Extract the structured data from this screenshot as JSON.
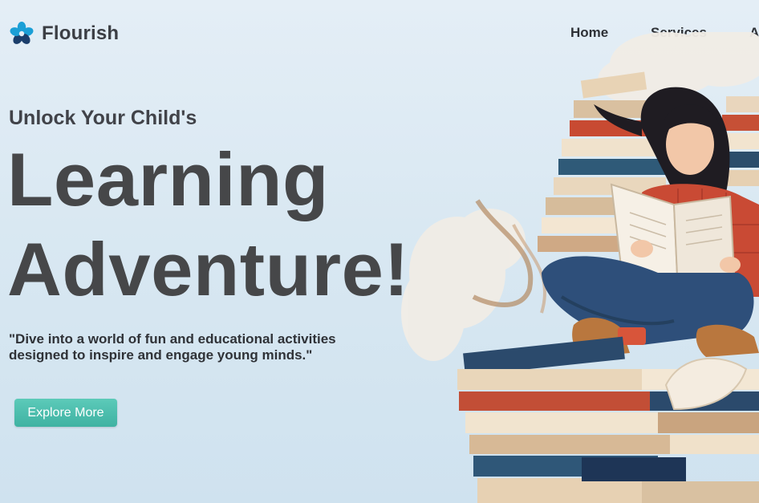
{
  "brand": {
    "name": "Flourish",
    "logo_icon": "flower-icon",
    "logo_colors": [
      "#1b9fd6",
      "#1b3e6b"
    ]
  },
  "nav": {
    "items": [
      "Home",
      "Services",
      "A"
    ]
  },
  "hero": {
    "eyebrow": "Unlock Your Child's",
    "headline_line1": "Learning",
    "headline_line2": "Adventure!",
    "tagline": "\"Dive into a world of fun and educational activities designed to inspire and engage young minds.\"",
    "cta_label": "Explore More",
    "cta_color": "#4dbfae"
  },
  "illustration": {
    "subject": "girl reading on stack of books"
  },
  "colors": {
    "background": "#dce9f3",
    "heading": "#464749",
    "text": "#2f3237"
  }
}
